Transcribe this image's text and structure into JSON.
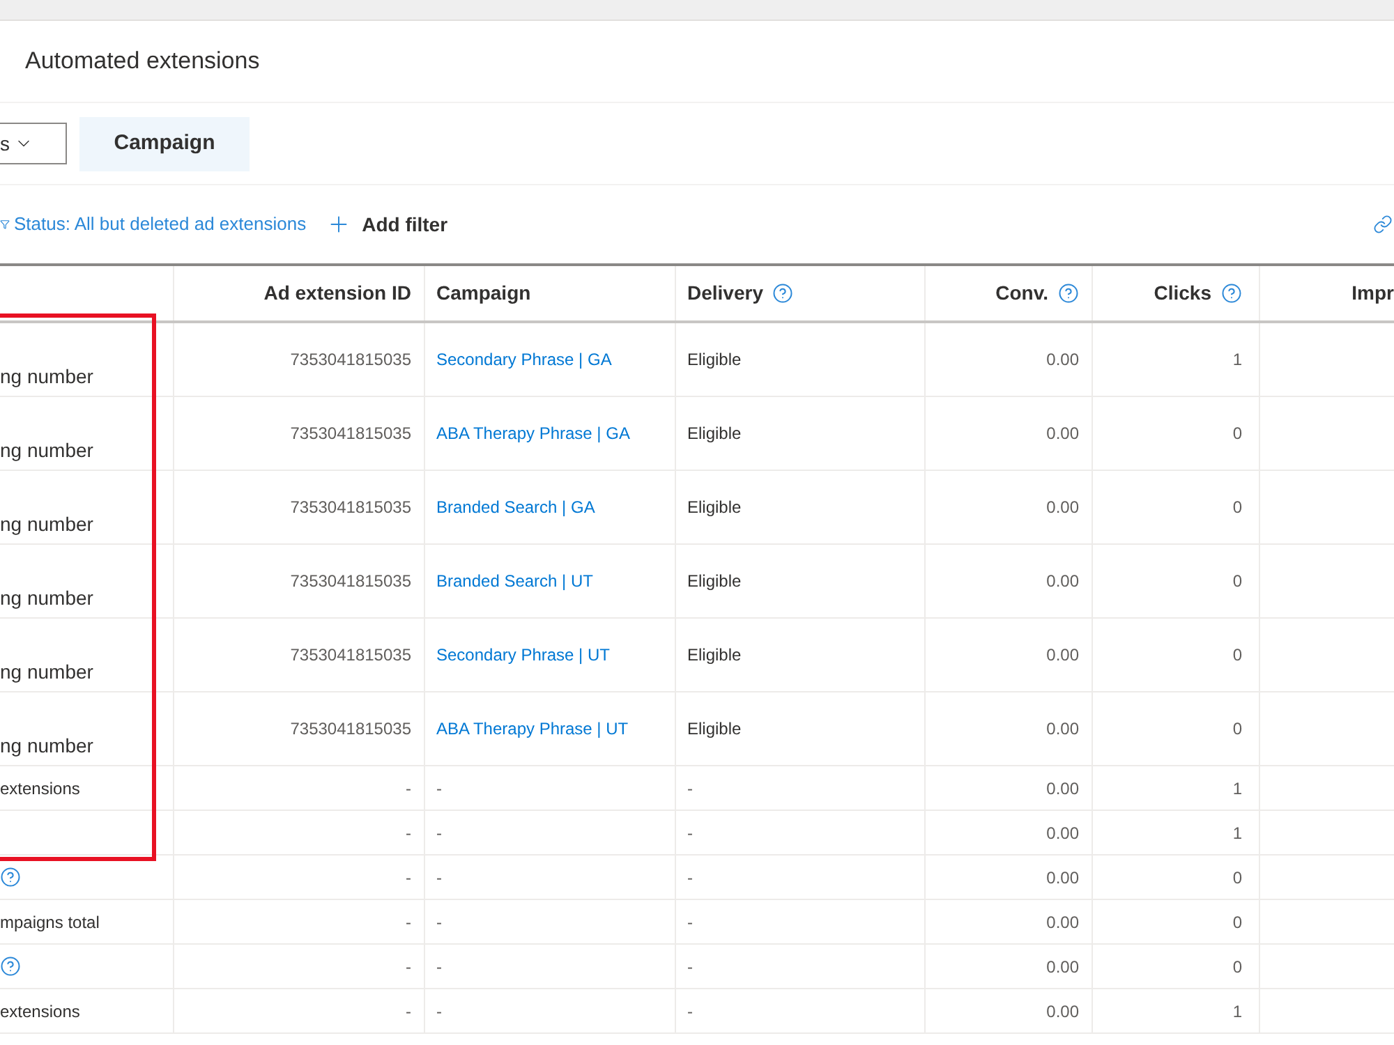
{
  "page": {
    "title": "Automated extensions"
  },
  "toolbar": {
    "dropdown": {
      "value": "s"
    },
    "tabs": [
      {
        "label": "Campaign",
        "selected": true
      }
    ]
  },
  "filter_bar": {
    "status_filter": "Status: All but deleted ad extensions",
    "add_filter": "Add filter"
  },
  "table": {
    "columns": [
      {
        "label": "Ad extension ID",
        "help": false
      },
      {
        "label": "Campaign",
        "help": false
      },
      {
        "label": "Delivery",
        "help": true
      },
      {
        "label": "Conv.",
        "help": true
      },
      {
        "label": "Clicks",
        "help": true
      },
      {
        "label": "Impr",
        "help": false
      }
    ],
    "rows": [
      {
        "kind": "extension",
        "column_1": "ng number",
        "help": false,
        "cells": [
          "7353041815035",
          "Secondary Phrase | GA",
          "Eligible",
          "0.00",
          "1"
        ]
      },
      {
        "kind": "extension",
        "column_1": "ng number",
        "help": false,
        "cells": [
          "7353041815035",
          "ABA Therapy Phrase | GA",
          "Eligible",
          "0.00",
          "0"
        ]
      },
      {
        "kind": "extension",
        "column_1": "ng number",
        "help": false,
        "cells": [
          "7353041815035",
          "Branded Search | GA",
          "Eligible",
          "0.00",
          "0"
        ]
      },
      {
        "kind": "extension",
        "column_1": "ng number",
        "help": false,
        "cells": [
          "7353041815035",
          "Branded Search | UT",
          "Eligible",
          "0.00",
          "0"
        ]
      },
      {
        "kind": "extension",
        "column_1": "ng number",
        "help": false,
        "cells": [
          "7353041815035",
          "Secondary Phrase | UT",
          "Eligible",
          "0.00",
          "0"
        ]
      },
      {
        "kind": "extension",
        "column_1": "ng number",
        "help": false,
        "cells": [
          "7353041815035",
          "ABA Therapy Phrase | UT",
          "Eligible",
          "0.00",
          "0"
        ]
      },
      {
        "kind": "summary",
        "column_1": "extensions",
        "help": false,
        "cells": [
          "-",
          "-",
          "-",
          "0.00",
          "1"
        ]
      },
      {
        "kind": "summary",
        "help": false,
        "cells": [
          "-",
          "-",
          "-",
          "0.00",
          "1"
        ]
      },
      {
        "kind": "summary",
        "help": true,
        "cells": [
          "-",
          "-",
          "-",
          "0.00",
          "0"
        ]
      },
      {
        "kind": "summary",
        "column_1": "mpaigns total",
        "help": false,
        "cells": [
          "-",
          "-",
          "-",
          "0.00",
          "0"
        ]
      },
      {
        "kind": "summary",
        "help": true,
        "cells": [
          "-",
          "-",
          "-",
          "0.00",
          "0"
        ]
      },
      {
        "kind": "summary",
        "column_1": "extensions",
        "help": false,
        "cells": [
          "-",
          "-",
          "-",
          "0.00",
          "1"
        ]
      }
    ]
  },
  "annotation": {
    "kind": "rectangle"
  }
}
